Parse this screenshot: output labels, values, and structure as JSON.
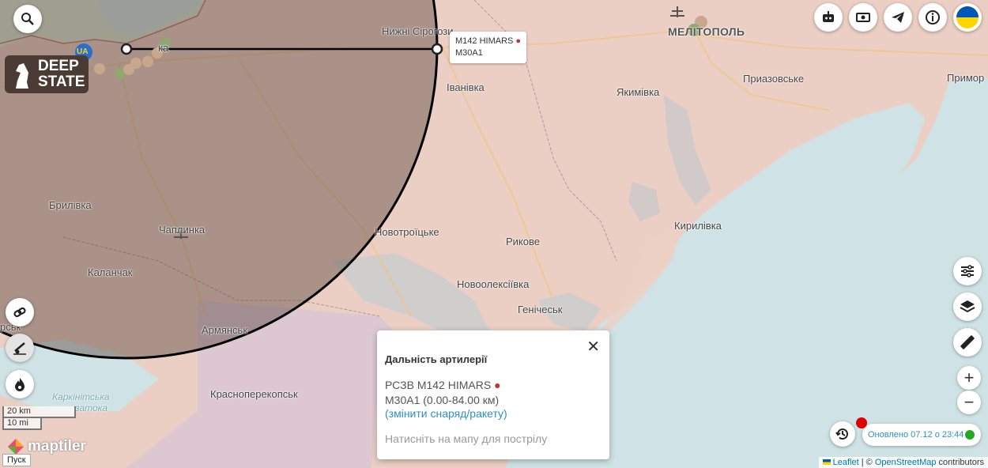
{
  "places": {
    "nyzhni_sirohozy": "Нижні Сірогози",
    "melitopol": "МЕЛІТОПОЛЬ",
    "prryazovske": "Приазовське",
    "prymorsk": "Примор",
    "ivanivka": "Іванівка",
    "yakymivka": "Якимівка",
    "brylivka": "Брилівка",
    "chaplynka": "Чаплинка",
    "novotroitske": "Новотроїцьке",
    "rykove": "Рикове",
    "kyrylivka": "Кирилівка",
    "kalanchak": "Каланчак",
    "novooleksiivka": "Новоолексіївка",
    "henichesk": "Генічеськ",
    "armiansk": "Армянськ",
    "krasnoperekopsk": "Красноперекопськ",
    "karkinitska": "Каркінітська",
    "zatoka": "затока",
    "kakhovka_frag": "ка",
    "hersk": "рськ"
  },
  "logo": {
    "line1": "DEEP",
    "line2": "STATE",
    "ua_badge": "UA"
  },
  "range_tooltip": {
    "line1": "M142 HIMARS",
    "line2": "M30A1"
  },
  "popup": {
    "title": "Дальність артилерії",
    "weapon": "РСЗВ M142 HIMARS",
    "ammo": "M30A1 (0.00-84.00 км)",
    "change_link": "(змінити снаряд/ракету)",
    "hint": "Натисніть на мапу для пострілу",
    "close_label": "✕"
  },
  "scale": {
    "km": "20 km",
    "mi": "10 mi"
  },
  "maptiler_label": "maptiler",
  "start_button": "Пуск",
  "updated": {
    "text": "Оновлено 07.12 о 23:44",
    "status_color": "#22aa22",
    "alert_color": "#e00000"
  },
  "attribution": {
    "leaflet": "Leaflet",
    "sep": " | © ",
    "osm": "OpenStreetMap",
    "contrib": " contributors"
  },
  "zoom": {
    "in": "+",
    "out": "−"
  },
  "icons": [
    "search-icon",
    "robot-icon",
    "money-icon",
    "telegram-icon",
    "info-icon",
    "ukraine-flag-icon",
    "filters-icon",
    "layers-icon",
    "ruler-icon",
    "history-icon",
    "link-icon",
    "artillery-icon",
    "fire-icon"
  ],
  "colors": {
    "occupied": "#eccfc4",
    "free": "#d8e6d0",
    "sea": "#cfe3e6",
    "range_circle": "#000000"
  }
}
